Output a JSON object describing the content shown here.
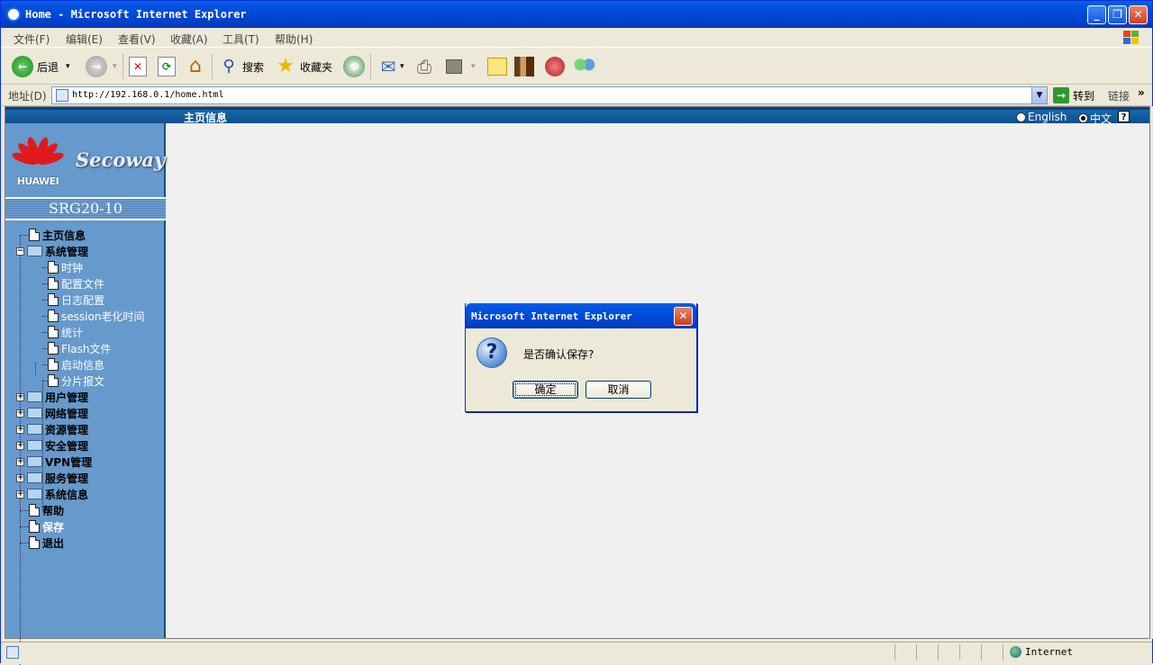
{
  "window": {
    "title": "Home - Microsoft Internet Explorer",
    "minimize_label": "_",
    "maximize_label": "❐",
    "close_label": "✕"
  },
  "menu": [
    {
      "label": "文件(F)"
    },
    {
      "label": "编辑(E)"
    },
    {
      "label": "查看(V)"
    },
    {
      "label": "收藏(A)"
    },
    {
      "label": "工具(T)"
    },
    {
      "label": "帮助(H)"
    }
  ],
  "toolbar": {
    "back_label": "后退",
    "search_label": "搜索",
    "favorites_label": "收藏夹",
    "dropdown_glyph": "▾",
    "back_arrow": "←",
    "forward_arrow": "→",
    "stop_glyph": "✕",
    "refresh_glyph": "⟳",
    "home_glyph": "⌂",
    "search_glyph": "⚲",
    "favorites_glyph": "★",
    "media_glyph": "⟲",
    "mail_glyph": "✉",
    "print_glyph": "⎙"
  },
  "address": {
    "label": "地址(D)",
    "url": "http://192.168.0.1/home.html",
    "dropdown_glyph": "▼",
    "go_glyph": "→",
    "go_label": "转到",
    "links_label": "链接",
    "chevron": "»"
  },
  "page": {
    "header_title": "主页信息",
    "lang_english": "English",
    "lang_chinese": "中文",
    "help_glyph": "?",
    "brand": "HUAWEI",
    "product": "Secoway",
    "model": "SRG20-10"
  },
  "tree": {
    "plus_glyph": "+",
    "minus_glyph": "−",
    "items": [
      {
        "label": "主页信息"
      },
      {
        "label": "系统管理"
      },
      {
        "label": "时钟"
      },
      {
        "label": "配置文件"
      },
      {
        "label": "日志配置"
      },
      {
        "label": "session老化时间"
      },
      {
        "label": "统计"
      },
      {
        "label": "Flash文件"
      },
      {
        "label": "启动信息"
      },
      {
        "label": "分片报文"
      },
      {
        "label": "用户管理"
      },
      {
        "label": "网络管理"
      },
      {
        "label": "资源管理"
      },
      {
        "label": "安全管理"
      },
      {
        "label": "VPN管理"
      },
      {
        "label": "服务管理"
      },
      {
        "label": "系统信息"
      },
      {
        "label": "帮助"
      },
      {
        "label": "保存"
      },
      {
        "label": "退出"
      }
    ]
  },
  "dialog": {
    "title": "Microsoft Internet Explorer",
    "close_label": "✕",
    "icon_glyph": "?",
    "message": "是否确认保存?",
    "ok_label": "确定",
    "cancel_label": "取消"
  },
  "status": {
    "zone": "Internet"
  },
  "colors": {
    "xp_blue": "#0052e0",
    "sidebar": "#6699cc",
    "header_band": "#1b67a8"
  }
}
